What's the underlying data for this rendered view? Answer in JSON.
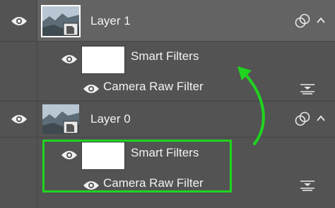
{
  "layers": [
    {
      "name": "Layer 1",
      "selected": true,
      "smart_filters_label": "Smart Filters",
      "filter_label": "Camera Raw Filter"
    },
    {
      "name": "Layer 0",
      "selected": false,
      "smart_filters_label": "Smart Filters",
      "filter_label": "Camera Raw Filter"
    }
  ],
  "colors": {
    "panel_bg": "#535353",
    "selected_row_bg": "#626262",
    "annotation_green": "#1fd41f"
  },
  "icons": {
    "visibility": "eye-icon",
    "smart_object_badge": "smart-object-badge-icon",
    "link": "link-icon",
    "expand": "chevron-up-icon",
    "filter_options": "filter-blending-options-icon"
  }
}
